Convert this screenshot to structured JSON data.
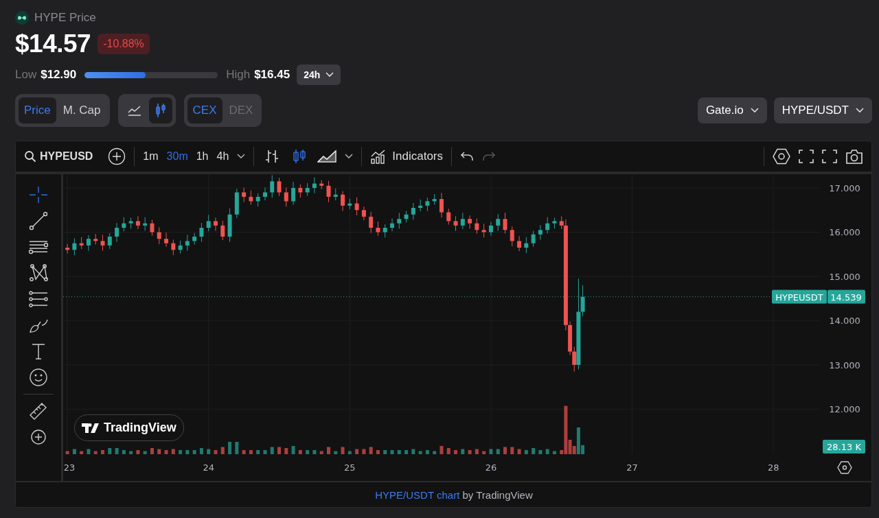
{
  "header": {
    "title": "HYPE Price",
    "price": "$14.57",
    "change": "-10.88%"
  },
  "range": {
    "low_label": "Low",
    "low": "$12.90",
    "high_label": "High",
    "high": "$16.45",
    "level": 0.46,
    "period": "24h"
  },
  "toggle_groups": [
    {
      "items": [
        {
          "kind": "text",
          "label": "Price",
          "selected": true
        },
        {
          "kind": "text",
          "label": "M. Cap",
          "selected": false
        }
      ]
    },
    {
      "items": [
        {
          "kind": "line",
          "selected": false
        },
        {
          "kind": "candles",
          "selected": true
        }
      ]
    },
    {
      "items": [
        {
          "kind": "text",
          "label": "CEX",
          "selected": true
        },
        {
          "kind": "text",
          "label": "DEX",
          "selected": false
        }
      ]
    }
  ],
  "selectors": [
    {
      "label": "Gate.io"
    },
    {
      "label": "HYPE/USDT"
    }
  ],
  "chart_toolbar": {
    "symbol": "HYPEUSD",
    "intervals": [
      {
        "label": "1m",
        "selected": false
      },
      {
        "label": "30m",
        "selected": true
      },
      {
        "label": "1h",
        "selected": false
      },
      {
        "label": "4h",
        "selected": false
      }
    ],
    "styles": [
      {
        "kind": "bars",
        "selected": false
      },
      {
        "kind": "candles",
        "selected": true
      },
      {
        "kind": "area",
        "selected": false
      }
    ],
    "indicators": "Indicators"
  },
  "drawing_tools": [
    {
      "kind": "crosshair",
      "selected": true
    },
    {
      "kind": "trend-line",
      "selected": false
    },
    {
      "kind": "lines",
      "selected": false
    },
    {
      "kind": "pattern",
      "selected": false
    },
    {
      "kind": "fib",
      "selected": false
    },
    {
      "kind": "brush",
      "selected": false
    },
    {
      "kind": "text",
      "selected": false
    },
    {
      "kind": "emoji",
      "selected": false
    },
    {
      "kind": "ruler",
      "selected": false
    },
    {
      "kind": "zoom",
      "selected": false
    }
  ],
  "chart": {
    "logo_text": "TradingView",
    "price_tag": {
      "symbol": "HYPEUSDT",
      "value": "14.539"
    },
    "volume_tag": "28.13 K",
    "chart_data": {
      "type": "candlestick",
      "grid": true,
      "xlim": [
        22.98,
        28.33
      ],
      "ylim": [
        10.98,
        17.31
      ],
      "ref_lines": [
        {
          "axis": "y",
          "value": 14.539,
          "line_style": "dotted"
        }
      ],
      "xticks": [
        {
          "value": 23,
          "label": "23"
        },
        {
          "value": 24,
          "label": "24"
        },
        {
          "value": 25,
          "label": "25"
        },
        {
          "value": 26,
          "label": "26"
        },
        {
          "value": 27,
          "label": "27"
        },
        {
          "value": 28,
          "label": "28"
        }
      ],
      "yticks": [
        {
          "value": 12,
          "label": "12.000"
        },
        {
          "value": 13,
          "label": "13.000"
        },
        {
          "value": 14,
          "label": "14.000"
        },
        {
          "value": 15,
          "label": "15.000"
        },
        {
          "value": 16,
          "label": "16.000"
        },
        {
          "value": 17,
          "label": "17.000"
        }
      ],
      "x": [
        23.0,
        23.05,
        23.1,
        23.15,
        23.2,
        23.25,
        23.3,
        23.35,
        23.4,
        23.45,
        23.5,
        23.55,
        23.6,
        23.65,
        23.7,
        23.75,
        23.8,
        23.85,
        23.9,
        23.95,
        24.0,
        24.05,
        24.1,
        24.15,
        24.2,
        24.25,
        24.3,
        24.35,
        24.4,
        24.45,
        24.5,
        24.55,
        24.6,
        24.65,
        24.7,
        24.75,
        24.8,
        24.85,
        24.9,
        24.95,
        25.0,
        25.05,
        25.1,
        25.15,
        25.2,
        25.25,
        25.3,
        25.35,
        25.4,
        25.45,
        25.5,
        25.55,
        25.6,
        25.65,
        25.7,
        25.75,
        25.8,
        25.85,
        25.9,
        25.95,
        26.0,
        26.05,
        26.1,
        26.15,
        26.2,
        26.25,
        26.3,
        26.35,
        26.4,
        26.45,
        26.5,
        26.53,
        26.56,
        26.59,
        26.62,
        26.65
      ],
      "ohlc": [
        [
          15.65,
          15.73,
          15.52,
          15.6
        ],
        [
          15.6,
          15.86,
          15.48,
          15.75
        ],
        [
          15.75,
          15.89,
          15.62,
          15.7
        ],
        [
          15.7,
          15.93,
          15.58,
          15.85
        ],
        [
          15.85,
          15.96,
          15.72,
          15.8
        ],
        [
          15.8,
          15.94,
          15.58,
          15.7
        ],
        [
          15.7,
          15.98,
          15.62,
          15.9
        ],
        [
          15.9,
          16.21,
          15.78,
          16.1
        ],
        [
          16.1,
          16.34,
          16.02,
          16.2
        ],
        [
          16.2,
          16.33,
          16.08,
          16.25
        ],
        [
          16.25,
          16.36,
          16.07,
          16.15
        ],
        [
          16.15,
          16.34,
          16.03,
          16.2
        ],
        [
          16.2,
          16.28,
          15.92,
          16.0
        ],
        [
          16.0,
          16.11,
          15.73,
          15.85
        ],
        [
          15.85,
          15.99,
          15.67,
          15.75
        ],
        [
          15.75,
          15.83,
          15.48,
          15.6
        ],
        [
          15.6,
          15.81,
          15.52,
          15.7
        ],
        [
          15.7,
          15.94,
          15.58,
          15.8
        ],
        [
          15.8,
          15.98,
          15.72,
          15.9
        ],
        [
          15.9,
          16.21,
          15.78,
          16.1
        ],
        [
          16.1,
          16.39,
          16.02,
          16.25
        ],
        [
          16.25,
          16.33,
          16.03,
          16.15
        ],
        [
          16.15,
          16.26,
          15.82,
          15.9
        ],
        [
          15.9,
          16.54,
          15.78,
          16.4
        ],
        [
          16.4,
          16.98,
          16.32,
          16.9
        ],
        [
          16.9,
          17.01,
          16.68,
          16.8
        ],
        [
          16.8,
          16.94,
          16.62,
          16.7
        ],
        [
          16.7,
          16.88,
          16.58,
          16.8
        ],
        [
          16.8,
          17.01,
          16.72,
          16.9
        ],
        [
          16.9,
          17.29,
          16.78,
          17.15
        ],
        [
          17.15,
          17.23,
          16.82,
          16.9
        ],
        [
          16.9,
          17.01,
          16.58,
          16.7
        ],
        [
          16.7,
          17.14,
          16.62,
          17.0
        ],
        [
          17.0,
          17.08,
          16.78,
          16.9
        ],
        [
          16.9,
          17.11,
          16.82,
          17.0
        ],
        [
          17.0,
          17.24,
          16.88,
          17.1
        ],
        [
          17.1,
          17.18,
          16.97,
          17.05
        ],
        [
          17.05,
          17.16,
          16.68,
          16.8
        ],
        [
          16.8,
          16.99,
          16.72,
          16.85
        ],
        [
          16.85,
          16.93,
          16.48,
          16.6
        ],
        [
          16.6,
          16.76,
          16.52,
          16.65
        ],
        [
          16.65,
          16.79,
          16.38,
          16.5
        ],
        [
          16.5,
          16.58,
          16.27,
          16.35
        ],
        [
          16.35,
          16.46,
          15.98,
          16.1
        ],
        [
          16.1,
          16.24,
          15.92,
          16.0
        ],
        [
          16.0,
          16.18,
          15.88,
          16.1
        ],
        [
          16.1,
          16.31,
          16.02,
          16.2
        ],
        [
          16.2,
          16.44,
          16.08,
          16.3
        ],
        [
          16.3,
          16.48,
          16.22,
          16.4
        ],
        [
          16.4,
          16.66,
          16.28,
          16.55
        ],
        [
          16.55,
          16.74,
          16.47,
          16.6
        ],
        [
          16.6,
          16.78,
          16.48,
          16.7
        ],
        [
          16.7,
          16.86,
          16.62,
          16.75
        ],
        [
          16.75,
          16.89,
          16.33,
          16.45
        ],
        [
          16.45,
          16.53,
          16.17,
          16.25
        ],
        [
          16.25,
          16.36,
          16.03,
          16.15
        ],
        [
          16.15,
          16.44,
          16.07,
          16.3
        ],
        [
          16.3,
          16.38,
          16.08,
          16.2
        ],
        [
          16.2,
          16.31,
          15.97,
          16.05
        ],
        [
          16.05,
          16.19,
          15.88,
          16.0
        ],
        [
          16.0,
          16.23,
          15.92,
          16.15
        ],
        [
          16.15,
          16.41,
          16.03,
          16.3
        ],
        [
          16.3,
          16.44,
          15.97,
          16.05
        ],
        [
          16.05,
          16.13,
          15.68,
          15.8
        ],
        [
          15.8,
          15.91,
          15.57,
          15.65
        ],
        [
          15.65,
          15.89,
          15.53,
          15.75
        ],
        [
          15.75,
          16.03,
          15.67,
          15.95
        ],
        [
          15.95,
          16.16,
          15.83,
          16.05
        ],
        [
          16.05,
          16.34,
          15.97,
          16.2
        ],
        [
          16.2,
          16.33,
          16.08,
          16.25
        ],
        [
          16.25,
          16.36,
          16.07,
          16.15
        ],
        [
          16.15,
          16.29,
          13.78,
          13.9
        ],
        [
          13.9,
          13.98,
          13.22,
          13.3
        ],
        [
          13.3,
          13.41,
          12.85,
          13.0
        ],
        [
          13.0,
          14.95,
          12.9,
          14.2
        ],
        [
          14.2,
          14.8,
          14.1,
          14.54
        ]
      ]
    }
  },
  "footer": {
    "link": "HYPE/USDT chart",
    "text": "by TradingView"
  }
}
